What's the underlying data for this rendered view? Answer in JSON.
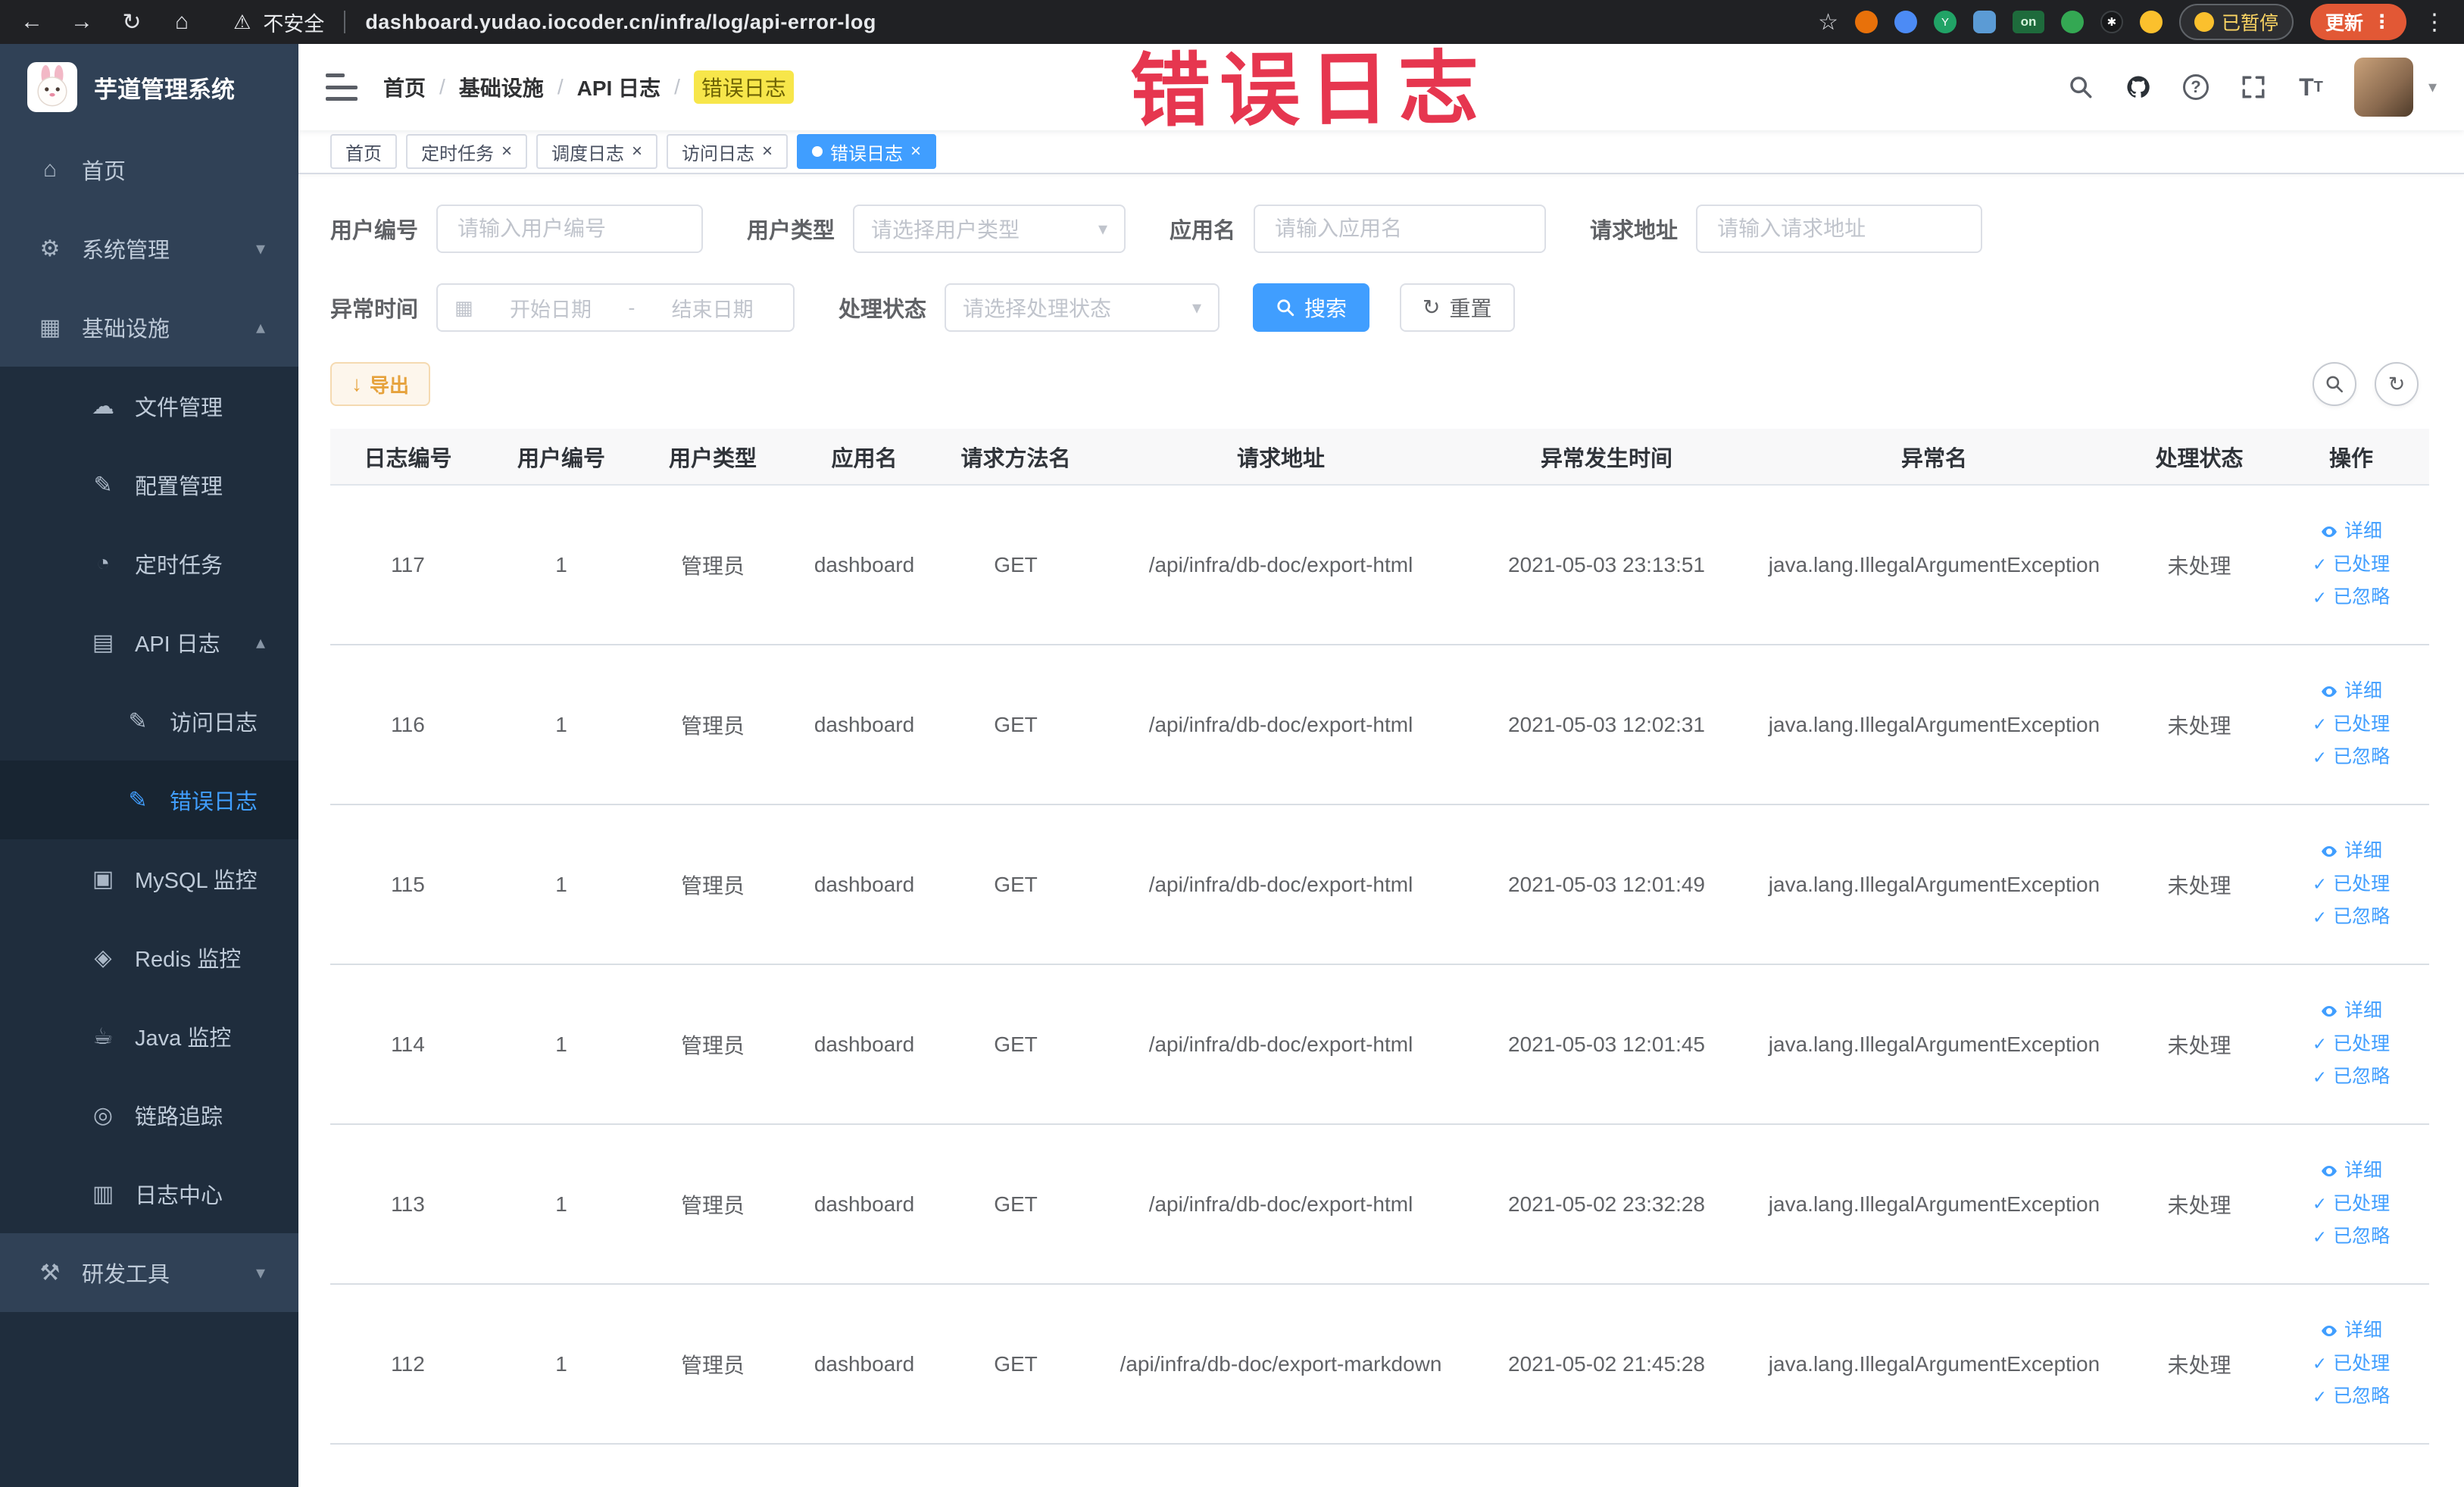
{
  "colors": {
    "accent": "#409eff",
    "warning": "#e6a23c",
    "annotation_red": "#e6364f",
    "sidebar_bg": "#304156",
    "sidebar_sub_bg": "#1f2d3d",
    "active_tab_bg": "#409eff"
  },
  "annotation": {
    "text": "错误日志"
  },
  "browser": {
    "security_label": "不安全",
    "url": "dashboard.yudao.iocoder.cn/infra/log/api-error-log",
    "extension_badge": "on",
    "paused_badge": "已暂停",
    "update_label": "更新"
  },
  "sidebar": {
    "logo_title": "芋道管理系统",
    "items": [
      {
        "label": "首页"
      },
      {
        "label": "系统管理"
      },
      {
        "label": "基础设施"
      },
      {
        "label": "文件管理"
      },
      {
        "label": "配置管理"
      },
      {
        "label": "定时任务"
      },
      {
        "label": "API 日志"
      },
      {
        "label": "访问日志"
      },
      {
        "label": "错误日志"
      },
      {
        "label": "MySQL 监控"
      },
      {
        "label": "Redis 监控"
      },
      {
        "label": "Java 监控"
      },
      {
        "label": "链路追踪"
      },
      {
        "label": "日志中心"
      },
      {
        "label": "研发工具"
      }
    ]
  },
  "breadcrumb": {
    "separator": "/",
    "items": [
      "首页",
      "基础设施",
      "API 日志",
      "错误日志"
    ]
  },
  "tabs": [
    {
      "label": "首页"
    },
    {
      "label": "定时任务"
    },
    {
      "label": "调度日志"
    },
    {
      "label": "访问日志"
    },
    {
      "label": "错误日志"
    }
  ],
  "filters": {
    "user_id_label": "用户编号",
    "user_id_placeholder": "请输入用户编号",
    "user_type_label": "用户类型",
    "user_type_placeholder": "请选择用户类型",
    "app_name_label": "应用名",
    "app_name_placeholder": "请输入应用名",
    "request_url_label": "请求地址",
    "request_url_placeholder": "请输入请求地址",
    "time_label": "异常时间",
    "time_start_placeholder": "开始日期",
    "time_separator": "-",
    "time_end_placeholder": "结束日期",
    "status_label": "处理状态",
    "status_placeholder": "请选择处理状态",
    "search_label": "搜索",
    "reset_label": "重置"
  },
  "toolbar": {
    "export_label": "导出"
  },
  "table": {
    "columns": [
      "日志编号",
      "用户编号",
      "用户类型",
      "应用名",
      "请求方法名",
      "请求地址",
      "异常发生时间",
      "异常名",
      "处理状态",
      "操作"
    ],
    "actions": {
      "detail": "详细",
      "processed": "已处理",
      "ignored": "已忽略"
    },
    "rows": [
      {
        "id": "117",
        "user_id": "1",
        "user_type": "管理员",
        "app_name": "dashboard",
        "method": "GET",
        "url": "/api/infra/db-doc/export-html",
        "time": "2021-05-03 23:13:51",
        "exception": "java.lang.IllegalArgumentException",
        "status": "未处理"
      },
      {
        "id": "116",
        "user_id": "1",
        "user_type": "管理员",
        "app_name": "dashboard",
        "method": "GET",
        "url": "/api/infra/db-doc/export-html",
        "time": "2021-05-03 12:02:31",
        "exception": "java.lang.IllegalArgumentException",
        "status": "未处理"
      },
      {
        "id": "115",
        "user_id": "1",
        "user_type": "管理员",
        "app_name": "dashboard",
        "method": "GET",
        "url": "/api/infra/db-doc/export-html",
        "time": "2021-05-03 12:01:49",
        "exception": "java.lang.IllegalArgumentException",
        "status": "未处理"
      },
      {
        "id": "114",
        "user_id": "1",
        "user_type": "管理员",
        "app_name": "dashboard",
        "method": "GET",
        "url": "/api/infra/db-doc/export-html",
        "time": "2021-05-03 12:01:45",
        "exception": "java.lang.IllegalArgumentException",
        "status": "未处理"
      },
      {
        "id": "113",
        "user_id": "1",
        "user_type": "管理员",
        "app_name": "dashboard",
        "method": "GET",
        "url": "/api/infra/db-doc/export-html",
        "time": "2021-05-02 23:32:28",
        "exception": "java.lang.IllegalArgumentException",
        "status": "未处理"
      },
      {
        "id": "112",
        "user_id": "1",
        "user_type": "管理员",
        "app_name": "dashboard",
        "method": "GET",
        "url": "/api/infra/db-doc/export-markdown",
        "time": "2021-05-02 21:45:28",
        "exception": "java.lang.IllegalArgumentException",
        "status": "未处理"
      }
    ]
  }
}
